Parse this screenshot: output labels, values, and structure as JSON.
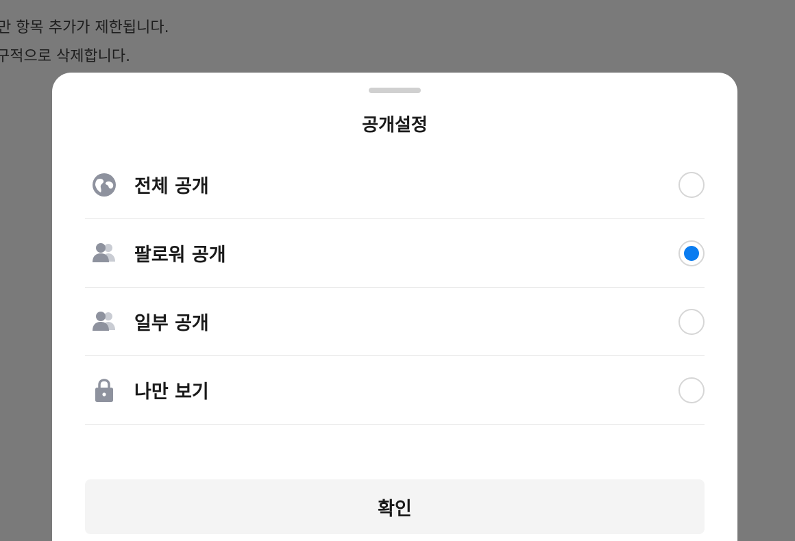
{
  "background": {
    "line1": "만 항목 추가가 제한됩니다.",
    "line2": "구적으로 삭제합니다."
  },
  "sheet": {
    "title": "공개설정",
    "options": [
      {
        "label": "전체 공개",
        "icon": "globe-icon",
        "selected": false
      },
      {
        "label": "팔로워 공개",
        "icon": "users-icon",
        "selected": true
      },
      {
        "label": "일부 공개",
        "icon": "users-icon",
        "selected": false
      },
      {
        "label": "나만 보기",
        "icon": "lock-icon",
        "selected": false
      }
    ],
    "confirm_label": "확인"
  },
  "colors": {
    "overlay": "#7a7a7a",
    "accent": "#0a7cf0",
    "icon": "#8e929e"
  }
}
